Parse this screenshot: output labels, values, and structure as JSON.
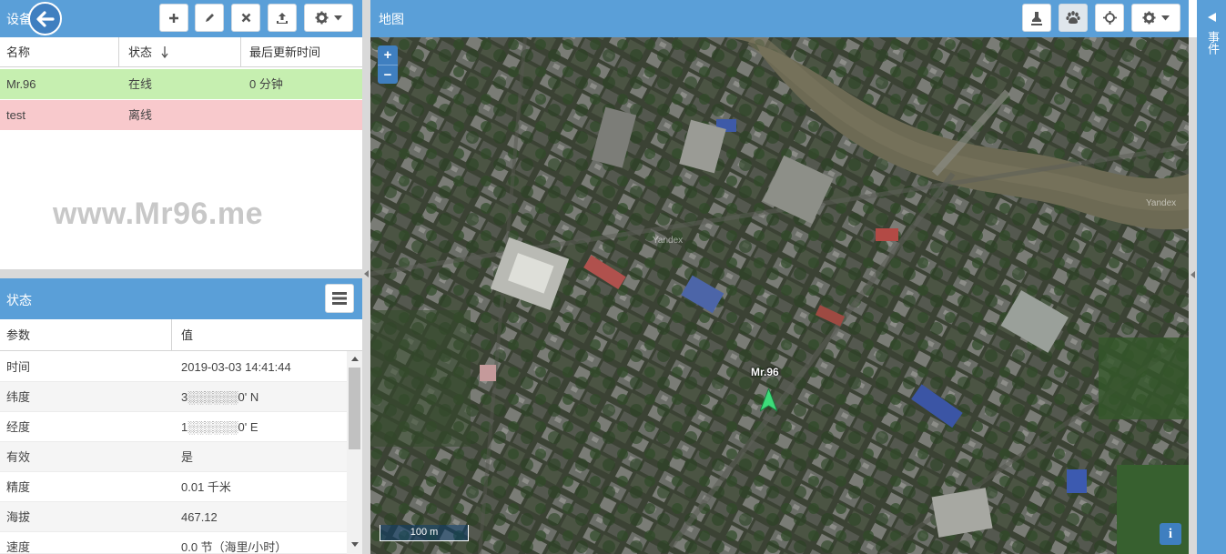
{
  "devices_panel": {
    "title": "设备",
    "columns": {
      "name": "名称",
      "status": "状态",
      "last_update": "最后更新时间"
    },
    "rows": [
      {
        "name": "Mr.96",
        "status": "在线",
        "last_update": "0 分钟"
      },
      {
        "name": "test",
        "status": "离线",
        "last_update": ""
      }
    ],
    "toolbar_icons": [
      "plus-icon",
      "pencil-icon",
      "remove-icon",
      "upload-icon",
      "gear-icon"
    ]
  },
  "watermark": "www.Mr96.me",
  "status_panel": {
    "title": "状态",
    "columns": {
      "param": "参数",
      "value": "值"
    },
    "rows": [
      {
        "key": "时间",
        "value": "2019-03-03 14:41:44"
      },
      {
        "key": "纬度",
        "value": "3░░░░░░0' N"
      },
      {
        "key": "经度",
        "value": "1░░░░░░0' E"
      },
      {
        "key": "有效",
        "value": "是"
      },
      {
        "key": "精度",
        "value": "0.01 千米"
      },
      {
        "key": "海拔",
        "value": "467.12"
      },
      {
        "key": "速度",
        "value": "0.0 节（海里/小时）"
      }
    ]
  },
  "map_panel": {
    "title": "地图",
    "zoom_in": "+",
    "zoom_out": "−",
    "scale": "100 m",
    "info": "i",
    "device_label": "Mr.96",
    "attribution": "Yandex",
    "attribution_2": "Yandex"
  },
  "right_strip": {
    "text": "事件"
  },
  "colors": {
    "header": "#5a9fd8",
    "online": "#c6efb0",
    "offline": "#f8c9cc",
    "marker": "#3ddc7a"
  }
}
